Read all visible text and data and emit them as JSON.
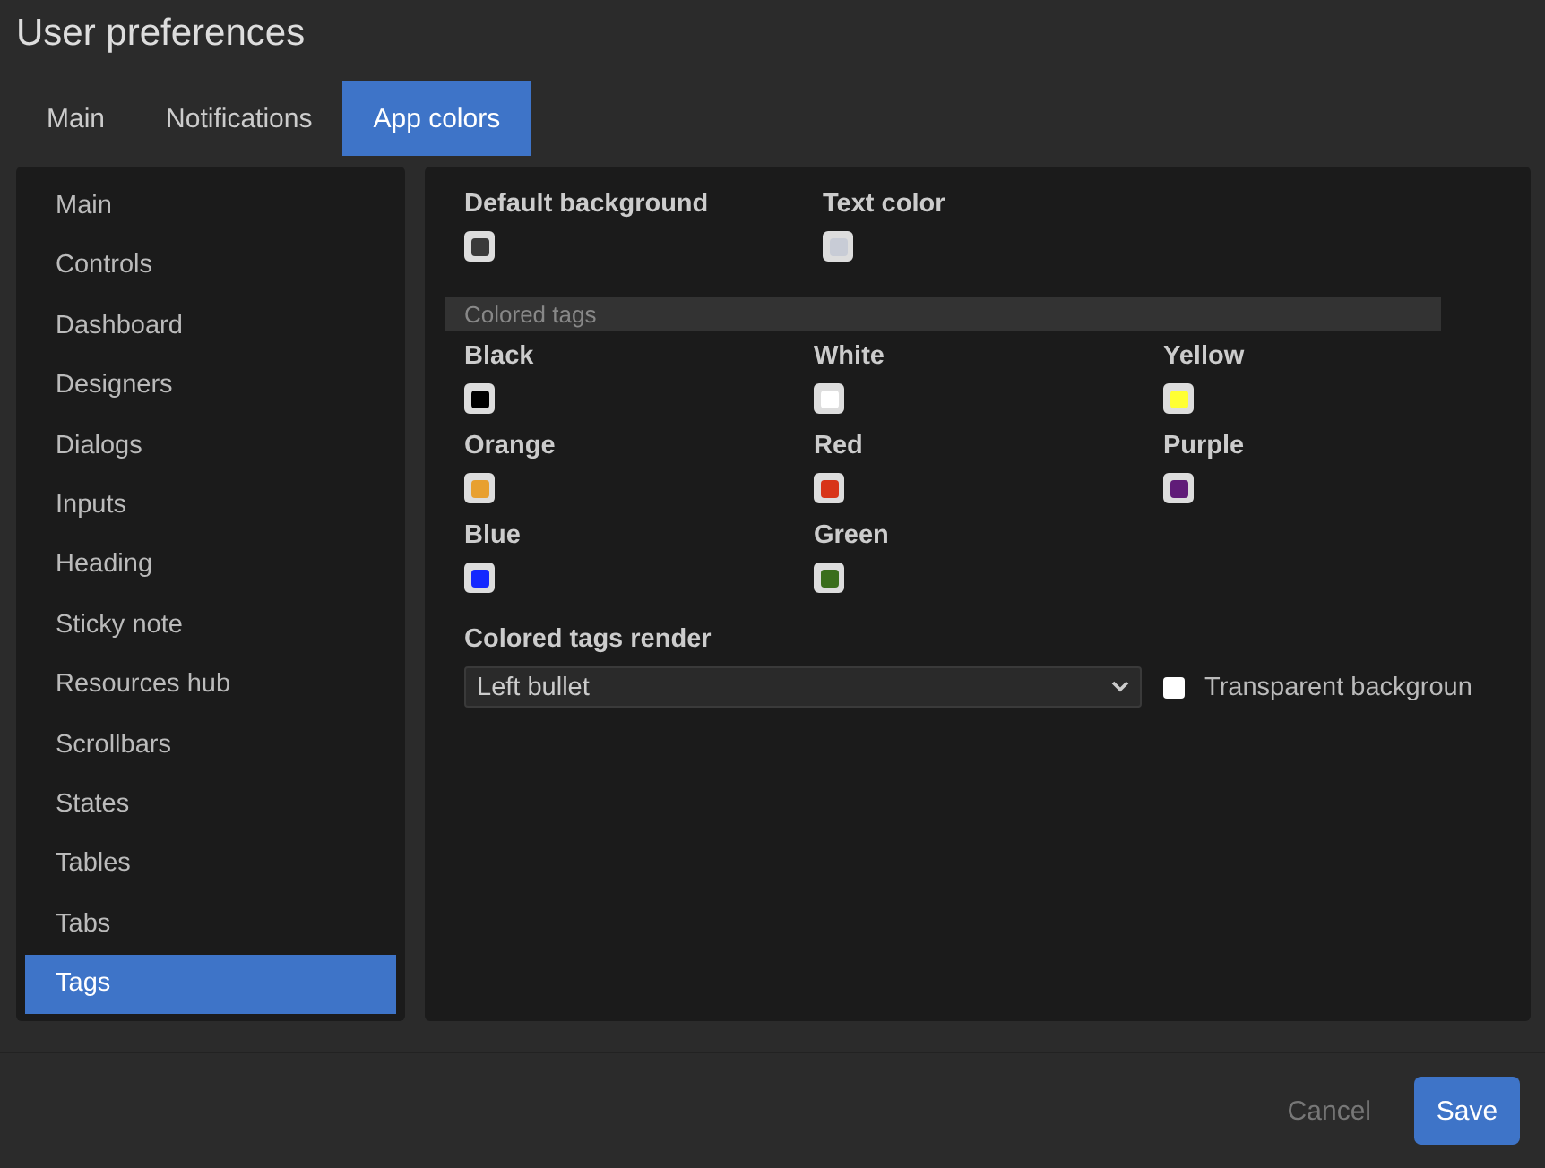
{
  "window": {
    "title": "User preferences"
  },
  "tabs": [
    {
      "label": "Main",
      "selected": false
    },
    {
      "label": "Notifications",
      "selected": false
    },
    {
      "label": "App colors",
      "selected": true
    }
  ],
  "sidebar": {
    "items": [
      {
        "label": "Main",
        "selected": false
      },
      {
        "label": "Controls",
        "selected": false
      },
      {
        "label": "Dashboard",
        "selected": false
      },
      {
        "label": "Designers",
        "selected": false
      },
      {
        "label": "Dialogs",
        "selected": false
      },
      {
        "label": "Inputs",
        "selected": false
      },
      {
        "label": "Heading",
        "selected": false
      },
      {
        "label": "Sticky note",
        "selected": false
      },
      {
        "label": "Resources hub",
        "selected": false
      },
      {
        "label": "Scrollbars",
        "selected": false
      },
      {
        "label": "States",
        "selected": false
      },
      {
        "label": "Tables",
        "selected": false
      },
      {
        "label": "Tabs",
        "selected": false
      },
      {
        "label": "Tags",
        "selected": true
      }
    ]
  },
  "base_colors": [
    {
      "label": "Default background",
      "color": "#3a3a3a"
    },
    {
      "label": "Text color",
      "color": "#c8ccd6"
    }
  ],
  "colored_tags": {
    "heading": "Colored tags",
    "items": [
      {
        "label": "Black",
        "color": "#000000"
      },
      {
        "label": "White",
        "color": "#ffffff"
      },
      {
        "label": "Yellow",
        "color": "#ffff33"
      },
      {
        "label": "Orange",
        "color": "#e8a030"
      },
      {
        "label": "Red",
        "color": "#d83418"
      },
      {
        "label": "Purple",
        "color": "#601c78"
      },
      {
        "label": "Blue",
        "color": "#1428ff"
      },
      {
        "label": "Green",
        "color": "#3a6e1c"
      }
    ]
  },
  "render": {
    "label": "Colored tags render",
    "value": "Left bullet",
    "transparent_background": {
      "label": "Transparent backgroun",
      "checked": false
    }
  },
  "buttons": [
    {
      "label": "Cancel",
      "kind": "secondary"
    },
    {
      "label": "Save",
      "kind": "primary"
    }
  ]
}
